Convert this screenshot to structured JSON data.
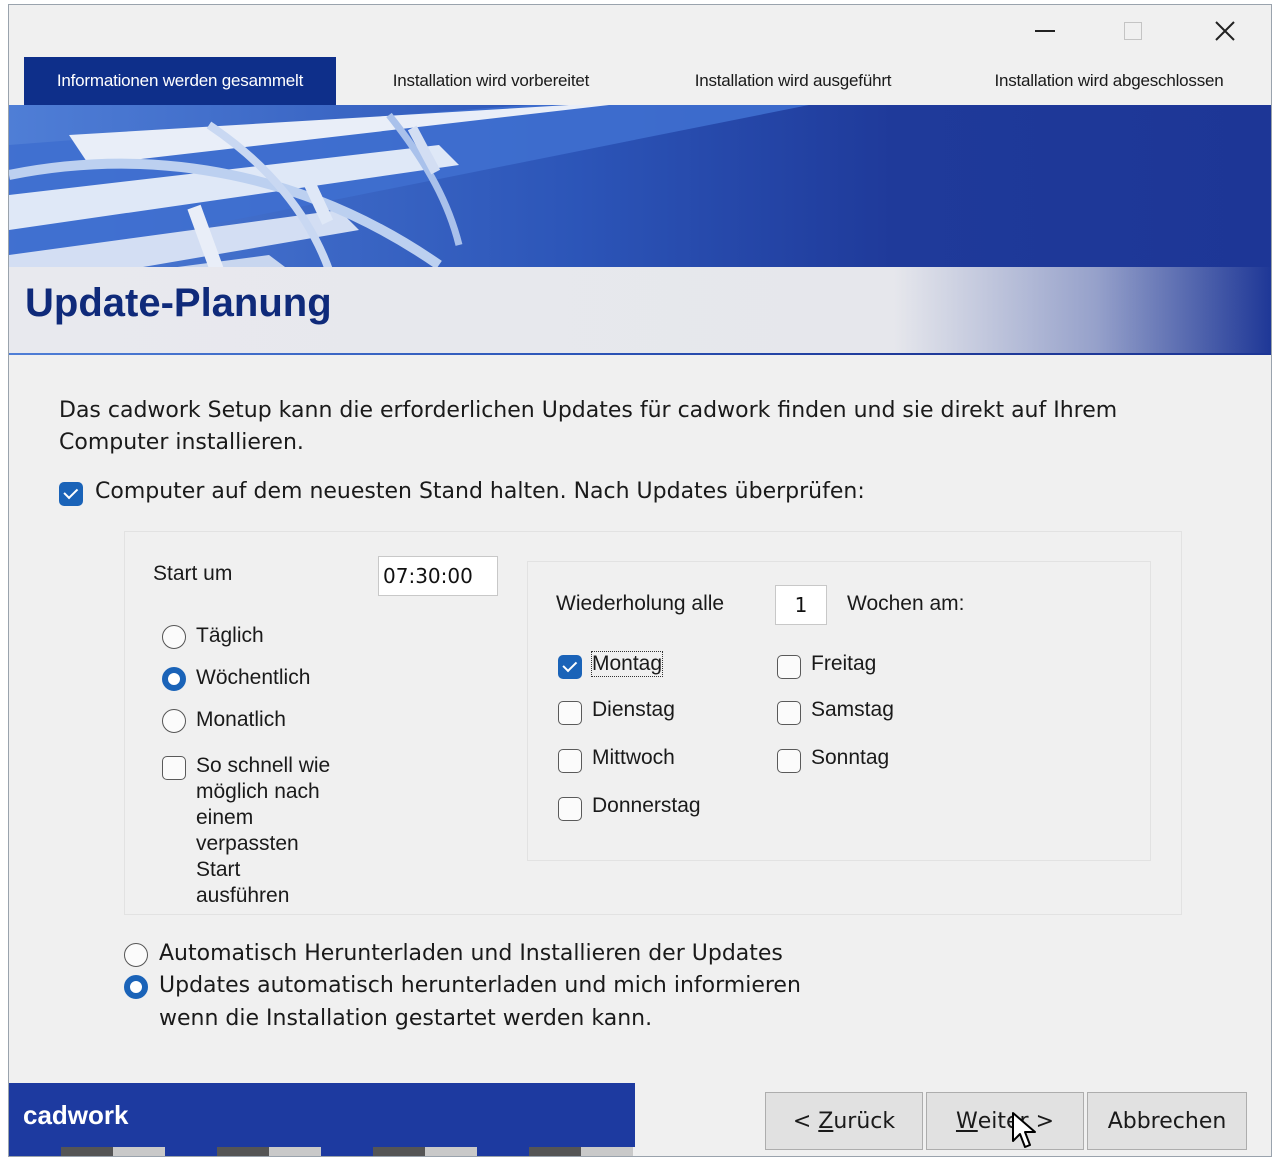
{
  "window": {
    "controls": {
      "minimize": "minimize-icon",
      "maximize": "maximize-icon",
      "close": "close-icon",
      "close_glyph": "✕"
    }
  },
  "tabs": [
    {
      "label": "Informationen werden gesammelt",
      "active": true
    },
    {
      "label": "Installation wird vorbereitet",
      "active": false
    },
    {
      "label": "Installation wird ausgeführt",
      "active": false
    },
    {
      "label": "Installation wird abgeschlossen",
      "active": false
    }
  ],
  "page": {
    "title": "Update-Planung",
    "description_line1": "Das cadwork Setup kann die erforderlichen Updates für cadwork finden und sie direkt auf Ihrem",
    "description_line2": "Computer installieren."
  },
  "keep_updated": {
    "label": "Computer auf dem neuesten Stand halten. Nach Updates überprüfen:",
    "checked": true
  },
  "schedule": {
    "start_label": "Start um",
    "start_value": "07:30:00",
    "frequency_options": [
      {
        "label": "Täglich",
        "selected": false
      },
      {
        "label": "Wöchentlich",
        "selected": true
      },
      {
        "label": "Monatlich",
        "selected": false
      }
    ],
    "missed_start": {
      "lines": [
        "So schnell wie",
        "möglich nach",
        "einem",
        "verpassten",
        "Start",
        "ausführen"
      ],
      "checked": false
    },
    "repeat_label": "Wiederholung alle",
    "repeat_value": "1",
    "weeks_label": "Wochen am:",
    "days": [
      {
        "label": "Montag",
        "checked": true
      },
      {
        "label": "Dienstag",
        "checked": false
      },
      {
        "label": "Mittwoch",
        "checked": false
      },
      {
        "label": "Donnerstag",
        "checked": false
      },
      {
        "label": "Freitag",
        "checked": false
      },
      {
        "label": "Samstag",
        "checked": false
      },
      {
        "label": "Sonntag",
        "checked": false
      }
    ]
  },
  "install_mode": {
    "options": [
      {
        "label": "Automatisch Herunterladen und Installieren der Updates",
        "selected": false
      },
      {
        "label": "Updates automatisch herunterladen und mich informieren",
        "label_line2": "wenn die Installation gestartet werden kann.",
        "selected": true
      }
    ]
  },
  "footer": {
    "brand": "cadwork",
    "back_prefix": "< ",
    "back_accel": "Z",
    "back_rest": "urück",
    "next_accel": "W",
    "next_rest": "eiter >",
    "cancel": "Abbrechen"
  },
  "colors": {
    "accent_dark_blue": "#0e2f8a",
    "title_blue": "#0f2a7a",
    "checkbox_blue": "#1a63b8",
    "banner_blue": "#1f3a9a"
  }
}
